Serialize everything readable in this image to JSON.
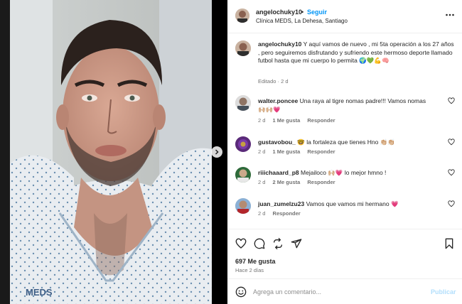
{
  "header": {
    "username": "angelochuky10",
    "separator": "•",
    "follow_label": "Seguir",
    "location": "Clínica MEDS, La Dehesa, Santiago",
    "more_icon": "more-horizontal-icon"
  },
  "media": {
    "gown_logo_text": "MEDS",
    "next_icon": "chevron-right-icon"
  },
  "caption": {
    "username": "angelochuky10",
    "text": "Y aquí vamos de nuevo , mi 5ta operación a los 27 años , pero seguiremos disfrutando y sufriendo este hermoso deporte llamado futbol hasta que mi cuerpo lo permita",
    "emojis": "🌍💚💪🧠",
    "edited": "Editado",
    "age": "2 d"
  },
  "comments": [
    {
      "username": "walter.poncee",
      "text": "Una raya al tigre nomas padre!!! Vamos nomas",
      "emojis_after": "🙌🏼🙌🏼💗",
      "age": "2 d",
      "likes": "1 Me gusta",
      "reply": "Responder"
    },
    {
      "username": "gustavobou_",
      "emojis_before": "🤓",
      "text": "la fortaleza que tienes Hno",
      "emojis_after": "👏🏼👏🏼",
      "age": "2 d",
      "likes": "1 Me gusta",
      "reply": "Responder"
    },
    {
      "username": "riiichaaard_p8",
      "text": "Mejailoco",
      "emojis_mid": "🙌🏼💗",
      "text2": "lo mejor hmno !",
      "age": "2 d",
      "likes": "2 Me gusta",
      "reply": "Responder"
    },
    {
      "username": "juan_zumelzu23",
      "text": "Vamos que vamos mi hermano",
      "emojis_after": "💗",
      "age": "2 d",
      "likes": "",
      "reply": "Responder"
    }
  ],
  "actions": {
    "like_icon": "heart-icon",
    "comment_icon": "comment-icon",
    "share_icon": "share-icon",
    "repost_icon": "repost-icon",
    "save_icon": "bookmark-icon"
  },
  "likes_count": "697 Me gusta",
  "posted_ago": "Hace 2 días",
  "composer": {
    "placeholder": "Agrega un comentario...",
    "publish_label": "Publicar",
    "emoji_icon": "smile-icon"
  }
}
